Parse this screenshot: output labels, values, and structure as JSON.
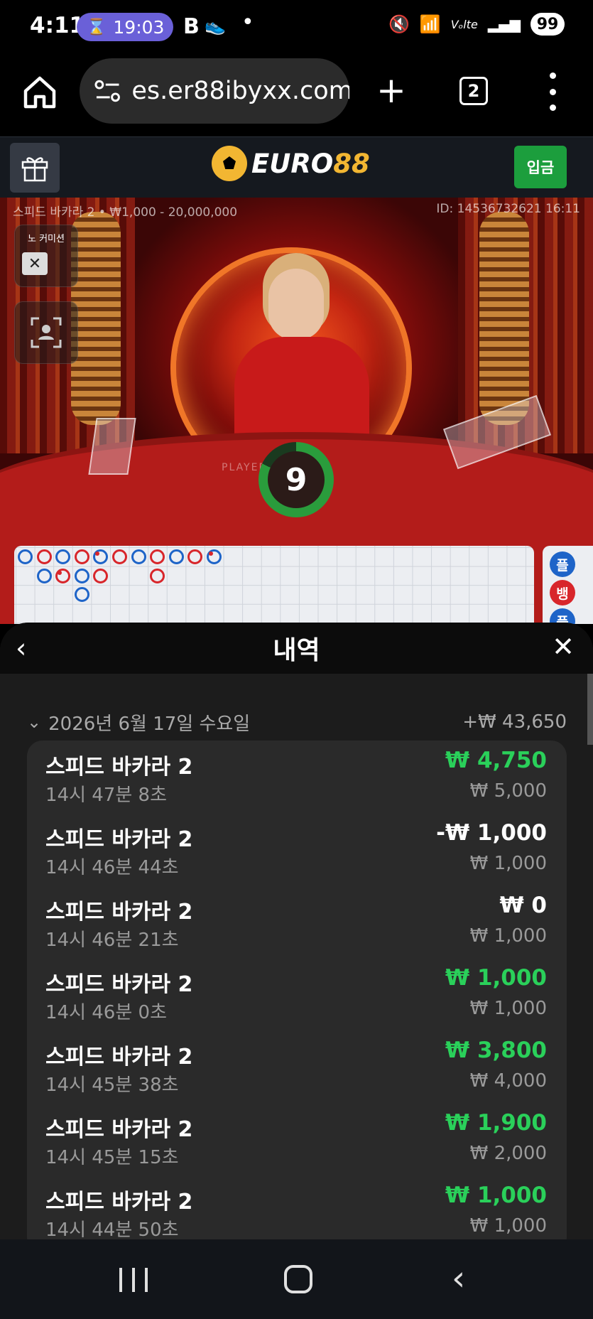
{
  "status_bar": {
    "time": "4:11",
    "timer": "19:03",
    "battery": "99",
    "b_glyph": "B",
    "shoe_glyph": "👟",
    "dot": "•",
    "mute": "🔇",
    "wifi": "📶",
    "volte": "Vₒlte",
    "signal": "▂▄▆",
    "hourglass": "⌛"
  },
  "browser": {
    "url": "es.er88ibyxx.com",
    "tab_count": "2",
    "plus": "+"
  },
  "site_header": {
    "logo_white": "EURO",
    "logo_yellow": "88",
    "deposit_label": "입금"
  },
  "game": {
    "info": "스피드 바카라 2 • ₩1,000 - 20,000,000",
    "id": "ID: 14536732621 16:11",
    "no_commission_label": "노 커미션",
    "x_label": "✕",
    "countdown": "9",
    "player_felt": "PLAYER",
    "road_chips": [
      {
        "label": "플",
        "color": "#1e64c8"
      },
      {
        "label": "뱅",
        "color": "#d8262b"
      },
      {
        "label": "플",
        "color": "#1e64c8"
      }
    ]
  },
  "roadmap": {
    "columns": [
      [
        "b"
      ],
      [
        "r",
        "b"
      ],
      [
        "b",
        "r*"
      ],
      [
        "r",
        "b",
        "b"
      ],
      [
        "b*",
        "r"
      ],
      [
        "r"
      ],
      [
        "b"
      ],
      [
        "r",
        "r"
      ],
      [
        "b"
      ],
      [
        "r"
      ],
      [
        "b*"
      ]
    ]
  },
  "history": {
    "title": "내역",
    "back_icon": "‹",
    "close_icon": "✕",
    "date": "2026년 6월 17일 수요일",
    "day_total": "+₩ 43,650",
    "chevron": "⌄",
    "items": [
      {
        "game": "스피드 바카라 2",
        "time": "14시 47분 8초",
        "result": "₩ 4,750",
        "type": "win",
        "stake": "₩ 5,000"
      },
      {
        "game": "스피드 바카라 2",
        "time": "14시 46분 44초",
        "result": "-₩ 1,000",
        "type": "neutral",
        "stake": "₩ 1,000"
      },
      {
        "game": "스피드 바카라 2",
        "time": "14시 46분 21초",
        "result": "₩ 0",
        "type": "neutral",
        "stake": "₩ 1,000"
      },
      {
        "game": "스피드 바카라 2",
        "time": "14시 46분 0초",
        "result": "₩ 1,000",
        "type": "win",
        "stake": "₩ 1,000"
      },
      {
        "game": "스피드 바카라 2",
        "time": "14시 45분 38초",
        "result": "₩ 3,800",
        "type": "win",
        "stake": "₩ 4,000"
      },
      {
        "game": "스피드 바카라 2",
        "time": "14시 45분 15초",
        "result": "₩ 1,900",
        "type": "win",
        "stake": "₩ 2,000"
      },
      {
        "game": "스피드 바카라 2",
        "time": "14시 44분 50초",
        "result": "₩ 1,000",
        "type": "win",
        "stake": "₩ 1,000"
      }
    ]
  },
  "nav": {
    "back_glyph": "‹"
  },
  "colors": {
    "win": "#2ad05a",
    "deposit": "#1c9e3d",
    "logo_yellow": "#f2b632",
    "banker_red": "#d8262b",
    "player_blue": "#1e64c8",
    "timer_green": "#2a9c3c"
  }
}
